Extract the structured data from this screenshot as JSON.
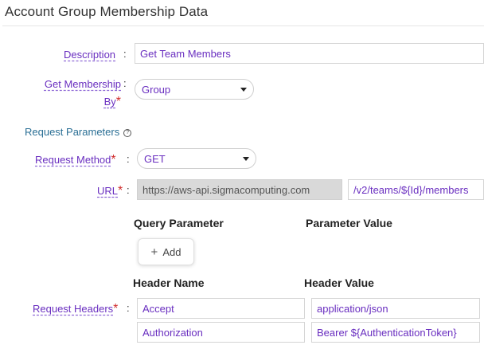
{
  "title": "Account Group Membership Data",
  "description": {
    "label": "Description",
    "value": "Get Team Members"
  },
  "membership": {
    "label_line1": "Get Membership",
    "label_line2": "By",
    "required": "*",
    "value": "Group"
  },
  "request_parameters": {
    "label": "Request Parameters",
    "info_glyph": "?"
  },
  "method": {
    "label": "Request Method",
    "required": "*",
    "value": "GET"
  },
  "url": {
    "label": "URL",
    "required": "*",
    "base": "https://aws-api.sigmacomputing.com",
    "path": "/v2/teams/${Id}/members"
  },
  "query": {
    "col_name": "Query Parameter",
    "col_value": "Parameter Value",
    "add_label": "Add",
    "add_glyph": "+"
  },
  "headers": {
    "label": "Request Headers",
    "required": "*",
    "col_name": "Header Name",
    "col_value": "Header Value",
    "rows": [
      {
        "name": "Accept",
        "value": "application/json"
      },
      {
        "name": "Authorization",
        "value": "Bearer ${AuthenticationToken}"
      }
    ]
  },
  "colon": ":"
}
